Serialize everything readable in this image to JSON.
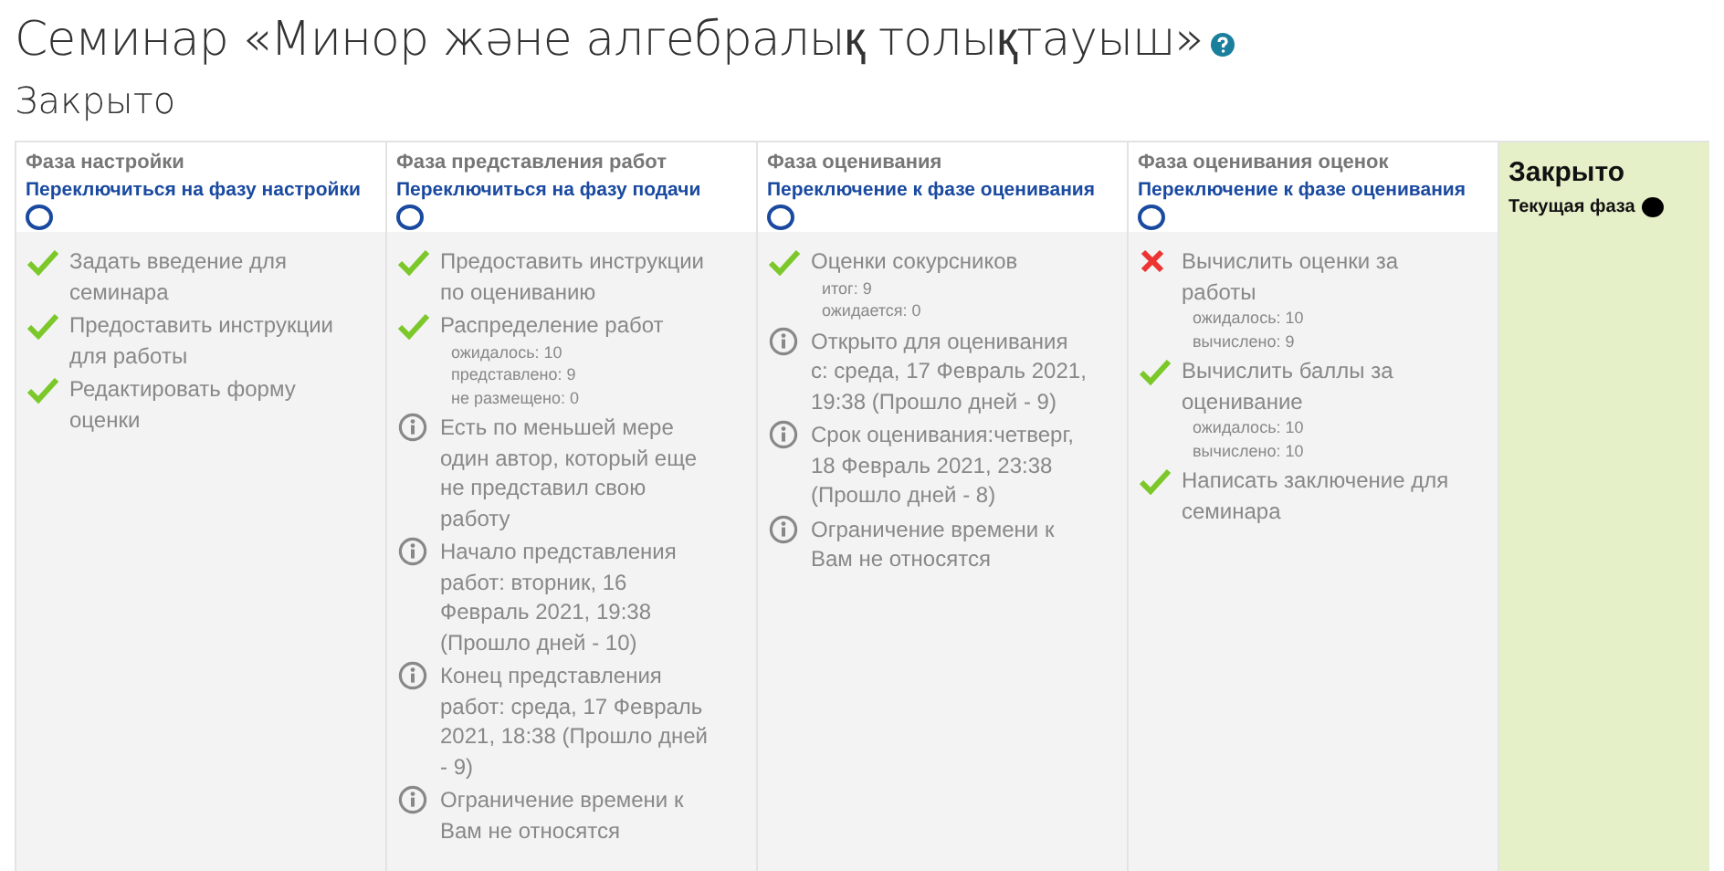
{
  "title": "Семинар «Минор және алгебралық толықтауыш»",
  "subtitle": "Закрыто",
  "phases": [
    {
      "name": "Фаза настройки",
      "switch_link": "Переключиться на фазу настройки",
      "current": false,
      "tasks": [
        {
          "kind": "done",
          "text": "Задать введение для семинара"
        },
        {
          "kind": "done",
          "text": "Предоставить инструкции для работы"
        },
        {
          "kind": "done",
          "text": "Редактировать форму оценки"
        }
      ]
    },
    {
      "name": "Фаза представления работ",
      "switch_link": "Переключиться на фазу подачи",
      "current": false,
      "tasks": [
        {
          "kind": "done",
          "text": "Предоставить инструкции по оцениванию"
        },
        {
          "kind": "done",
          "text": "Распределение работ",
          "details": [
            "ожидалось: 10",
            "представлено: 9",
            "не размещено: 0"
          ]
        },
        {
          "kind": "info",
          "text": "Есть по меньшей мере один автор, который еще не представил свою работу"
        },
        {
          "kind": "info",
          "text": "Начало представления работ: вторник, 16 Февраль 2021, 19:38 (Прошло дней - 10)"
        },
        {
          "kind": "info",
          "text": "Конец представления работ: среда, 17 Февраль 2021, 18:38 (Прошло дней - 9)"
        },
        {
          "kind": "info",
          "text": "Ограничение времени к Вам не относятся"
        }
      ]
    },
    {
      "name": "Фаза оценивания",
      "switch_link": "Переключение к фазе оценивания",
      "current": false,
      "tasks": [
        {
          "kind": "done",
          "text": "Оценки сокурсников",
          "details": [
            "итог: 9",
            "ожидается: 0"
          ]
        },
        {
          "kind": "info",
          "text": "Открыто для оценивания с: среда, 17 Февраль 2021, 19:38 (Прошло дней - 9)"
        },
        {
          "kind": "info",
          "text": "Срок оценивания:четверг, 18 Февраль 2021, 23:38 (Прошло дней - 8)"
        },
        {
          "kind": "info",
          "text": "Ограничение времени к Вам не относятся"
        }
      ]
    },
    {
      "name": "Фаза оценивания оценок",
      "switch_link": "Переключение к фазе оценивания",
      "current": false,
      "tasks": [
        {
          "kind": "fail",
          "text": "Вычислить оценки за работы",
          "details": [
            "ожидалось: 10",
            "вычислено: 9"
          ]
        },
        {
          "kind": "done",
          "text": "Вычислить баллы за оценивание",
          "details": [
            "ожидалось: 10",
            "вычислено: 10"
          ]
        },
        {
          "kind": "done",
          "text": "Написать заключение для семинара"
        }
      ]
    },
    {
      "name": "Закрыто",
      "current_label": "Текущая фаза",
      "current": true
    }
  ]
}
